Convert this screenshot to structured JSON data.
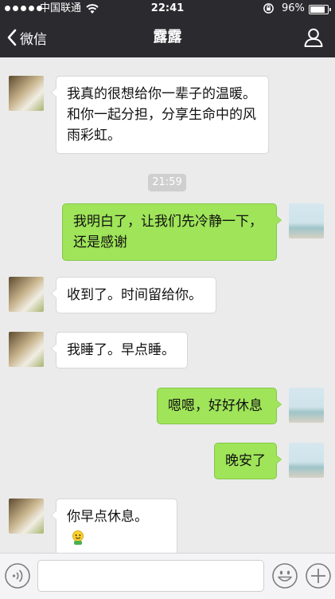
{
  "status_bar": {
    "carrier": "中国联通",
    "time": "22:41",
    "battery": "96%",
    "battery_level": 0.96
  },
  "nav": {
    "back_label": "微信",
    "title": "露露"
  },
  "messages": [
    {
      "from": "contact",
      "text": "我真的很想给你一辈子的温暖。和你一起分担，分享生命中的风雨彩虹。"
    },
    {
      "from": "me",
      "text": "我明白了，让我们先冷静一下，还是感谢"
    },
    {
      "from": "contact",
      "text": "收到了。时间留给你。"
    },
    {
      "from": "contact",
      "text": "我睡了。早点睡。"
    },
    {
      "from": "me",
      "text": "嗯嗯，好好休息"
    },
    {
      "from": "me",
      "text": "晚安了"
    },
    {
      "from": "contact",
      "text": "你早点休息。",
      "emoji": "smiling-face-emoji"
    }
  ],
  "timestamp": "21:59",
  "icons": {
    "back": "chevron-left-icon",
    "profile": "person-icon",
    "voice": "voice-icon",
    "emoji": "smiley-face-icon",
    "more": "plus-icon"
  },
  "colors": {
    "nav_bg": "#2a2a2f",
    "outgoing_bubble": "#9fe459",
    "incoming_bubble": "#ffffff",
    "background": "#ebebeb"
  }
}
